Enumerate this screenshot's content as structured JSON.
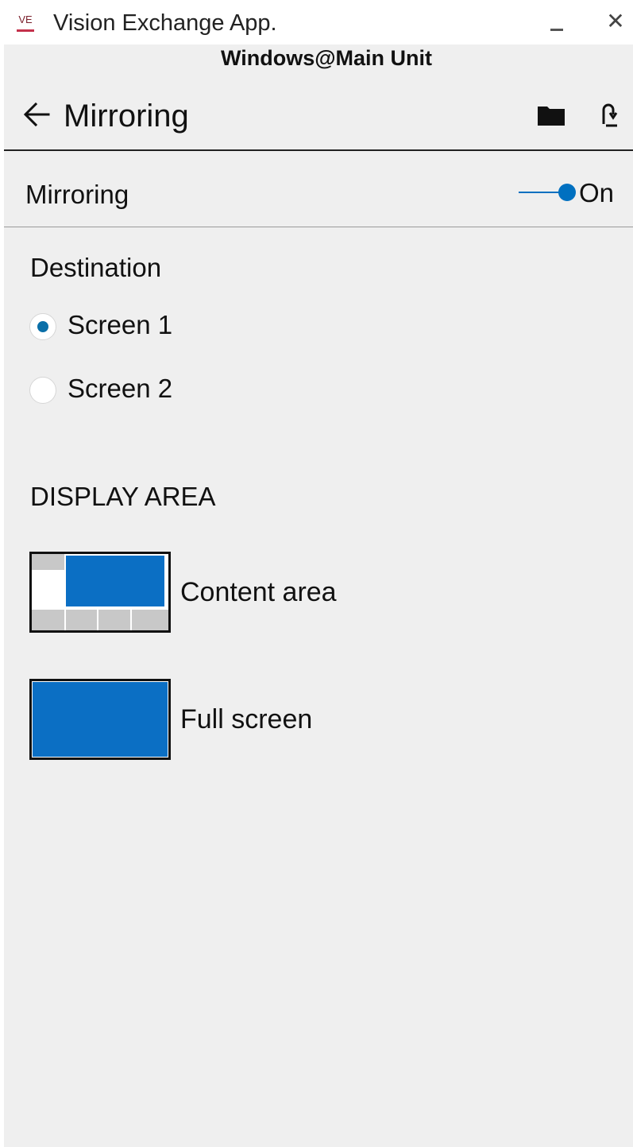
{
  "window": {
    "icon_text": "VE",
    "title": "Vision Exchange App.",
    "minimize_glyph": "—",
    "close_glyph": "✕"
  },
  "device": {
    "label": "Windows@Main Unit"
  },
  "header": {
    "title": "Mirroring",
    "icons": [
      "back-arrow-icon",
      "folder-icon",
      "refresh-icon"
    ]
  },
  "mirroring": {
    "label": "Mirroring",
    "toggle_state": "On",
    "enabled": true
  },
  "destination": {
    "title": "Destination",
    "options": [
      {
        "label": "Screen 1",
        "selected": true
      },
      {
        "label": "Screen 2",
        "selected": false
      }
    ]
  },
  "display_area": {
    "title": "DISPLAY AREA",
    "options": [
      {
        "label": "Content area"
      },
      {
        "label": "Full screen"
      }
    ]
  },
  "colors": {
    "accent": "#0070c0",
    "radio_dot": "#0a6fa8",
    "background": "#efefef",
    "thumbnail_blue": "#0b6fc4",
    "thumbnail_grey": "#c8c8c8"
  }
}
